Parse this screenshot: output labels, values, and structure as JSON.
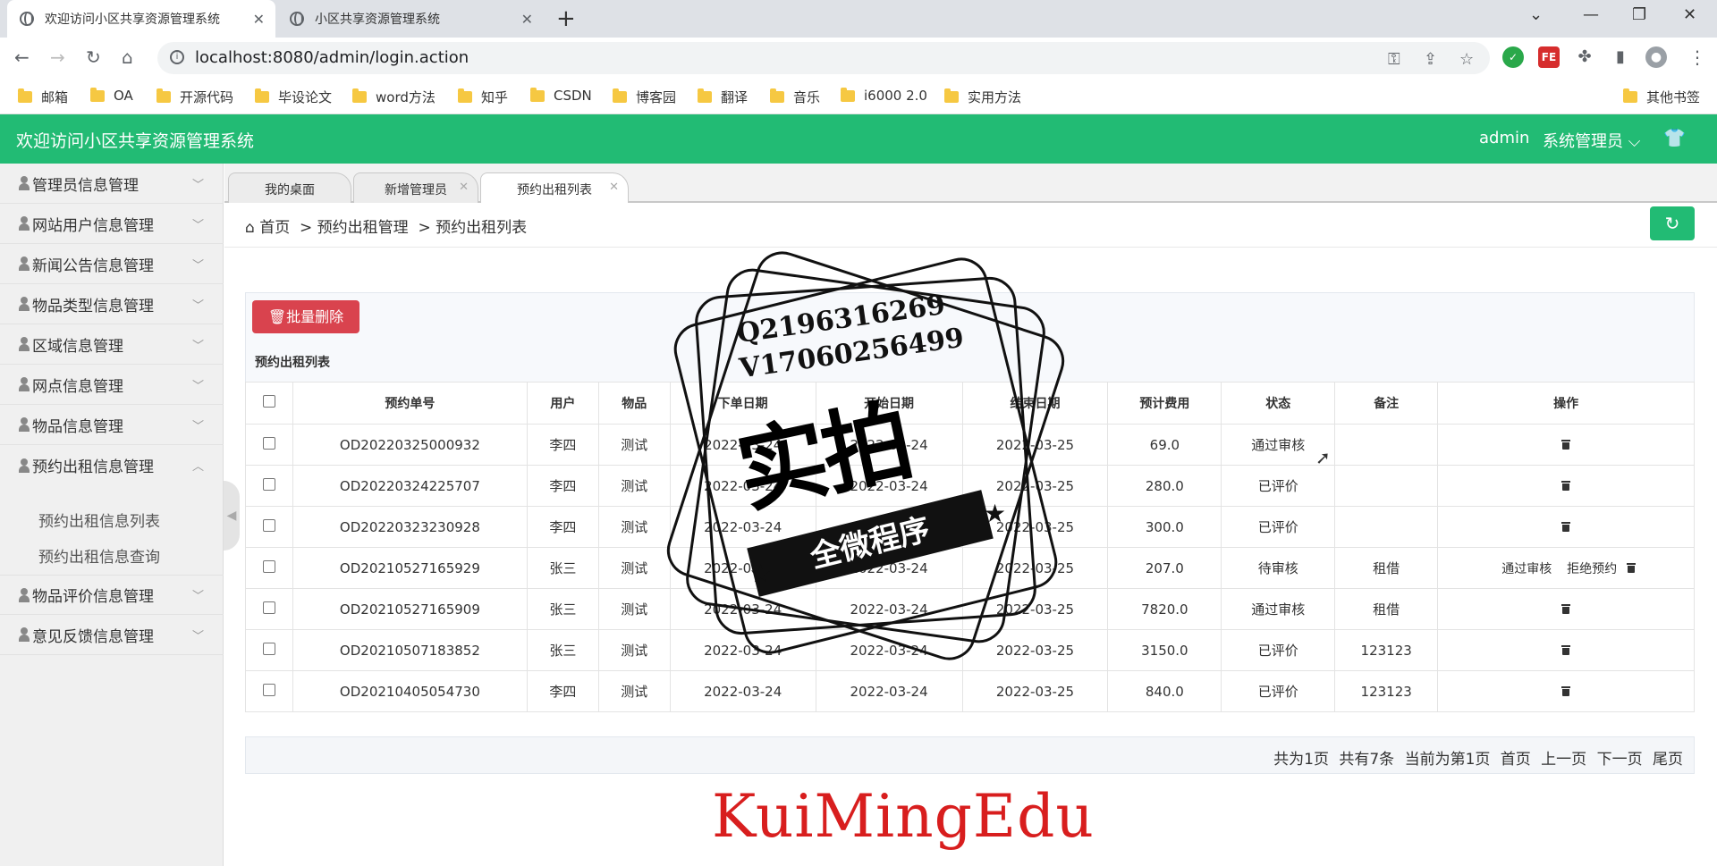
{
  "browser": {
    "tabs": [
      {
        "title": "欢迎访问小区共享资源管理系统",
        "active": true
      },
      {
        "title": "小区共享资源管理系统",
        "active": false
      }
    ],
    "url": "localhost:8080/admin/login.action",
    "bookmarks": [
      "邮箱",
      "OA",
      "开源代码",
      "毕设论文",
      "word方法",
      "知乎",
      "CSDN",
      "博客园",
      "翻译",
      "音乐",
      "i6000 2.0",
      "实用方法"
    ],
    "other_bookmarks": "其他书签",
    "extensions": {
      "fe": "FE"
    }
  },
  "header": {
    "title": "欢迎访问小区共享资源管理系统",
    "user": "admin",
    "role": "系统管理员"
  },
  "sidebar": {
    "items": [
      {
        "label": "管理员信息管理",
        "expanded": false
      },
      {
        "label": "网站用户信息管理",
        "expanded": false
      },
      {
        "label": "新闻公告信息管理",
        "expanded": false
      },
      {
        "label": "物品类型信息管理",
        "expanded": false
      },
      {
        "label": "区域信息管理",
        "expanded": false
      },
      {
        "label": "网点信息管理",
        "expanded": false
      },
      {
        "label": "物品信息管理",
        "expanded": false
      },
      {
        "label": "预约出租信息管理",
        "expanded": true
      },
      {
        "label": "物品评价信息管理",
        "expanded": false
      },
      {
        "label": "意见反馈信息管理",
        "expanded": false
      }
    ],
    "subitems": [
      "预约出租信息列表",
      "预约出租信息查询"
    ]
  },
  "content_tabs": [
    {
      "label": "我的桌面",
      "closable": false
    },
    {
      "label": "新增管理员",
      "closable": true
    },
    {
      "label": "预约出租列表",
      "closable": true,
      "active": true
    }
  ],
  "breadcrumb": {
    "home": "首页",
    "sep": ">",
    "level1": "预约出租管理",
    "level2": "预约出租列表"
  },
  "toolbar": {
    "batch_delete": "批量删除"
  },
  "list_title": "预约出租列表",
  "table": {
    "columns": [
      "预约单号",
      "用户",
      "物品",
      "下单日期",
      "开始日期",
      "结束日期",
      "预计费用",
      "状态",
      "备注",
      "操作"
    ],
    "rows": [
      {
        "order": "OD20220325000932",
        "user": "李四",
        "item": "测试",
        "order_date": "2022-03-24",
        "start": "2022-03-24",
        "end": "2022-03-25",
        "cost": "69.0",
        "status": "通过审核",
        "note": "",
        "ops": []
      },
      {
        "order": "OD20220324225707",
        "user": "李四",
        "item": "测试",
        "order_date": "2022-03-24",
        "start": "2022-03-24",
        "end": "2022-03-25",
        "cost": "280.0",
        "status": "已评价",
        "note": "",
        "ops": []
      },
      {
        "order": "OD20220323230928",
        "user": "李四",
        "item": "测试",
        "order_date": "2022-03-24",
        "start": "2022-03-24",
        "end": "2022-03-25",
        "cost": "300.0",
        "status": "已评价",
        "note": "",
        "ops": []
      },
      {
        "order": "OD20210527165929",
        "user": "张三",
        "item": "测试",
        "order_date": "2022-03-24",
        "start": "2022-03-24",
        "end": "2022-03-25",
        "cost": "207.0",
        "status": "待审核",
        "note": "租借",
        "ops": [
          "通过审核",
          "拒绝预约"
        ]
      },
      {
        "order": "OD20210527165909",
        "user": "张三",
        "item": "测试",
        "order_date": "2022-03-24",
        "start": "2022-03-24",
        "end": "2022-03-25",
        "cost": "7820.0",
        "status": "通过审核",
        "note": "租借",
        "ops": []
      },
      {
        "order": "OD20210507183852",
        "user": "张三",
        "item": "测试",
        "order_date": "2022-03-24",
        "start": "2022-03-24",
        "end": "2022-03-25",
        "cost": "3150.0",
        "status": "已评价",
        "note": "123123",
        "ops": []
      },
      {
        "order": "OD20210405054730",
        "user": "李四",
        "item": "测试",
        "order_date": "2022-03-24",
        "start": "2022-03-24",
        "end": "2022-03-25",
        "cost": "840.0",
        "status": "已评价",
        "note": "123123",
        "ops": []
      }
    ]
  },
  "pager": {
    "text": "共为1页 共有7条 当前为第1页 首页 上一页 下一页 尾页"
  },
  "watermarks": {
    "stamp_line1": "Q2196316269",
    "stamp_line2": "V17060256499",
    "stamp_big": "实拍",
    "stamp_ribbon": "全微程序",
    "brand": "KuiMingEdu"
  },
  "colors": {
    "primary": "#22bb74",
    "danger": "#d9434e",
    "brand_red": "#d81e1e"
  }
}
